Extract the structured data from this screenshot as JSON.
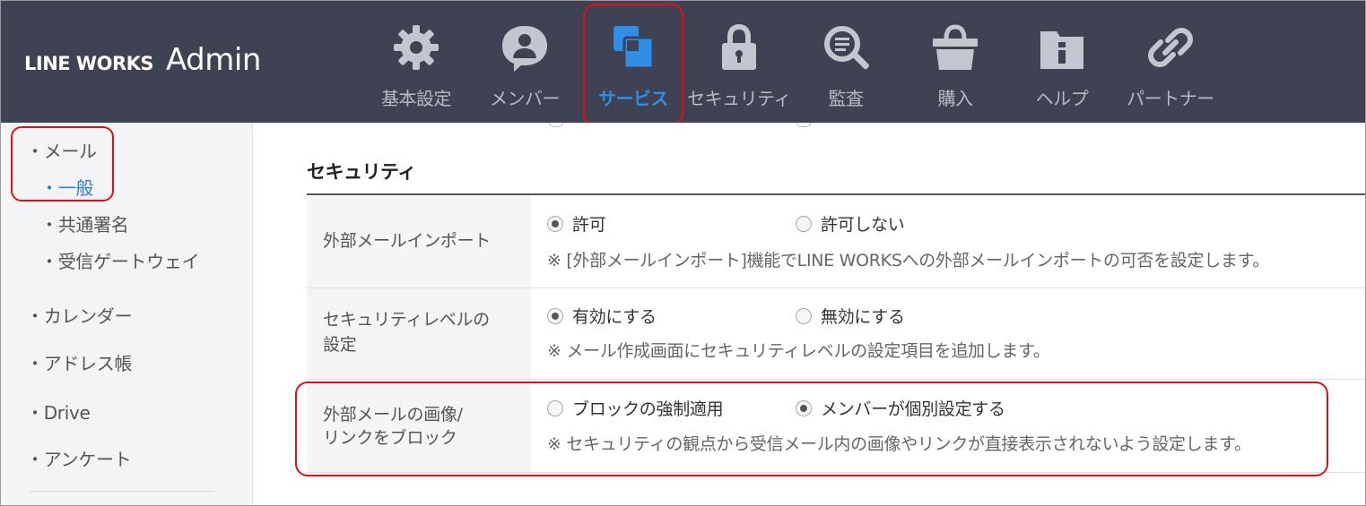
{
  "header": {
    "brand": "LINE WORKS",
    "admin": "Admin",
    "nav": [
      {
        "label": "基本設定",
        "icon": "gear-icon"
      },
      {
        "label": "メンバー",
        "icon": "member-icon"
      },
      {
        "label": "サービス",
        "icon": "service-icon",
        "active": true
      },
      {
        "label": "セキュリティ",
        "icon": "lock-icon"
      },
      {
        "label": "監査",
        "icon": "audit-search-icon"
      },
      {
        "label": "購入",
        "icon": "basket-icon"
      },
      {
        "label": "ヘルプ",
        "icon": "help-folder-icon"
      },
      {
        "label": "パートナー",
        "icon": "link-icon"
      }
    ]
  },
  "sidebar": {
    "items": [
      {
        "label": "・メール"
      },
      {
        "label": "・一般",
        "active": true
      },
      {
        "label": "・共通署名"
      },
      {
        "label": "・受信ゲートウェイ"
      },
      {
        "label": "・カレンダー"
      },
      {
        "label": "・アドレス帳"
      },
      {
        "label": "・Drive"
      },
      {
        "label": "・アンケート"
      }
    ]
  },
  "main": {
    "section_title": "セキュリティ",
    "rows": [
      {
        "label_lines": [
          "外部メールインポート"
        ],
        "options": [
          {
            "label": "許可",
            "checked": true
          },
          {
            "label": "許可しない",
            "checked": false
          }
        ],
        "note": "※ [外部メールインポート]機能でLINE WORKSへの外部メールインポートの可否を設定します。"
      },
      {
        "label_lines": [
          "セキュリティレベルの",
          "設定"
        ],
        "options": [
          {
            "label": "有効にする",
            "checked": true
          },
          {
            "label": "無効にする",
            "checked": false
          }
        ],
        "note": "※ メール作成画面にセキュリティレベルの設定項目を追加します。"
      },
      {
        "label_lines": [
          "外部メールの画像/",
          "リンクをブロック"
        ],
        "options": [
          {
            "label": "ブロックの強制適用",
            "checked": false
          },
          {
            "label": "メンバーが個別設定する",
            "checked": true
          }
        ],
        "note": "※ セキュリティの観点から受信メール内の画像やリンクが直接表示されないよう設定します。"
      }
    ]
  },
  "colors": {
    "header_bg": "#3f4253",
    "nav_label": "#b8bac4",
    "accent": "#2f8fe8",
    "highlight": "#e0101a",
    "sidebar_bg": "#f3f4f6"
  }
}
